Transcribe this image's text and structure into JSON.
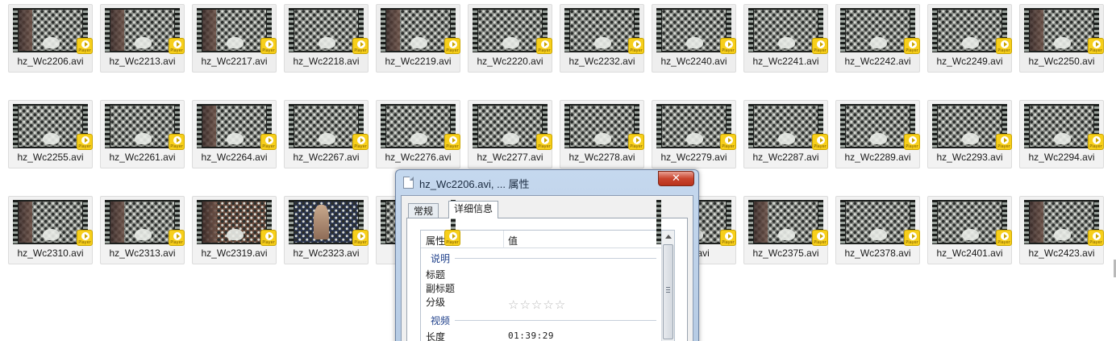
{
  "files": [
    {
      "name": "hz_Wc2206.avi",
      "thumb": "wall"
    },
    {
      "name": "hz_Wc2213.avi",
      "thumb": "wall"
    },
    {
      "name": "hz_Wc2217.avi",
      "thumb": "wall"
    },
    {
      "name": "hz_Wc2218.avi",
      "thumb": "plain"
    },
    {
      "name": "hz_Wc2219.avi",
      "thumb": "wall"
    },
    {
      "name": "hz_Wc2220.avi",
      "thumb": "plain"
    },
    {
      "name": "hz_Wc2232.avi",
      "thumb": "plain"
    },
    {
      "name": "hz_Wc2240.avi",
      "thumb": "plain"
    },
    {
      "name": "hz_Wc2241.avi",
      "thumb": "plain"
    },
    {
      "name": "hz_Wc2242.avi",
      "thumb": "plain"
    },
    {
      "name": "hz_Wc2249.avi",
      "thumb": "plain"
    },
    {
      "name": "hz_Wc2250.avi",
      "thumb": "wall"
    },
    {
      "name": "hz_Wc2255.avi",
      "thumb": "plain"
    },
    {
      "name": "hz_Wc2261.avi",
      "thumb": "plain"
    },
    {
      "name": "hz_Wc2264.avi",
      "thumb": "wall"
    },
    {
      "name": "hz_Wc2267.avi",
      "thumb": "plain"
    },
    {
      "name": "hz_Wc2276.avi",
      "thumb": "plain"
    },
    {
      "name": "hz_Wc2277.avi",
      "thumb": "plain"
    },
    {
      "name": "hz_Wc2278.avi",
      "thumb": "plain"
    },
    {
      "name": "hz_Wc2279.avi",
      "thumb": "plain"
    },
    {
      "name": "hz_Wc2287.avi",
      "thumb": "plain"
    },
    {
      "name": "hz_Wc2289.avi",
      "thumb": "plain"
    },
    {
      "name": "hz_Wc2293.avi",
      "thumb": "plain"
    },
    {
      "name": "hz_Wc2294.avi",
      "thumb": "plain"
    },
    {
      "name": "hz_Wc2310.avi",
      "thumb": "wall"
    },
    {
      "name": "hz_Wc2313.avi",
      "thumb": "wall"
    },
    {
      "name": "hz_Wc2319.avi",
      "thumb": "dark"
    },
    {
      "name": "hz_Wc2323.avi",
      "thumb": "person"
    },
    {
      "name": "hz",
      "thumb": "plain"
    },
    null,
    null,
    {
      "name": "337.avi",
      "thumb": "plain"
    },
    {
      "name": "hz_Wc2375.avi",
      "thumb": "wall"
    },
    {
      "name": "hz_Wc2378.avi",
      "thumb": "plain"
    },
    {
      "name": "hz_Wc2401.avi",
      "thumb": "plain"
    },
    {
      "name": "hz_Wc2423.avi",
      "thumb": "wall"
    }
  ],
  "badge_text": "Player",
  "dialog": {
    "title": "hz_Wc2206.avi, ... 属性",
    "close_glyph": "✕",
    "tabs": [
      {
        "label": "常规",
        "active": false
      },
      {
        "label": "详细信息",
        "active": true
      }
    ],
    "columns": {
      "property": "属性",
      "value": "值"
    },
    "groups": [
      {
        "label": "说明",
        "rows": [
          {
            "name": "标题",
            "value": ""
          },
          {
            "name": "副标题",
            "value": ""
          },
          {
            "name": "分级",
            "value": "☆☆☆☆☆",
            "type": "rating"
          }
        ]
      },
      {
        "label": "视频",
        "rows": [
          {
            "name": "长度",
            "value": "01:39:29"
          }
        ]
      }
    ]
  },
  "colors": {
    "badge": "#f7cf1b",
    "close_button": "#c9452e",
    "group_label": "#1e3f8a",
    "dialog_frame": "#c5d8ee"
  }
}
